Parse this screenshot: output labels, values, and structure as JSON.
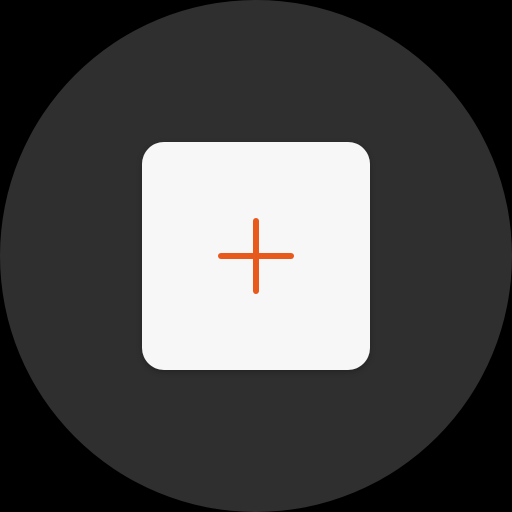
{
  "app_icon": {
    "icon": "plus-icon",
    "colors": {
      "background": "#000000",
      "circle": "#2f2f2f",
      "tile": "#f7f7f7",
      "accent": "#e85a1c"
    }
  }
}
